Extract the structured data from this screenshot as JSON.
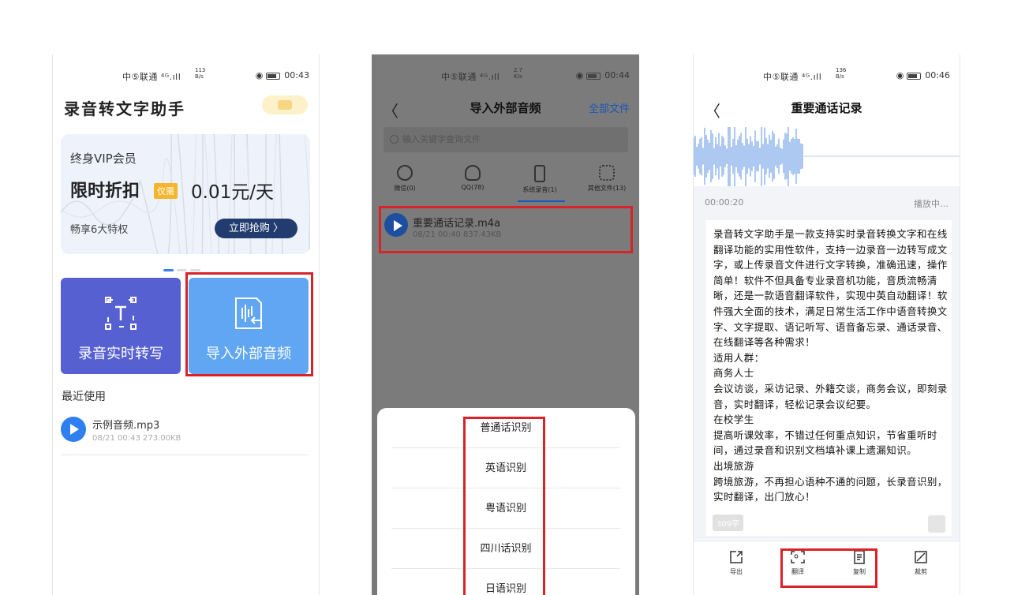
{
  "status_bars": {
    "p1": {
      "carrier": "中⑤联通 ⁴ᴳ.ıll",
      "speed": "113 B/s",
      "time": "00:43"
    },
    "p2": {
      "carrier": "中⑤联通 ⁴ᴳ.ıll",
      "speed": "2.7 K/s",
      "time": "00:44"
    },
    "p3": {
      "carrier": "中⑤联通 ⁴ᴳ.ıll",
      "speed": "136 B/s",
      "time": "00:46"
    }
  },
  "screen1": {
    "title": "录音转文字助手",
    "vip": {
      "title": "终身VIP会员",
      "promo": "限时折扣",
      "tag": "仅需",
      "price": "0.01元/天",
      "perk": "畅享6大特权",
      "button": "立即抢购 〉"
    },
    "tiles": {
      "record": "录音实时转写",
      "import": "导入外部音频"
    },
    "recent_title": "最近使用",
    "recent_item": {
      "name": "示例音频.mp3",
      "meta": "08/21 00:43   273.00KB"
    }
  },
  "screen2": {
    "back": "〈",
    "title": "导入外部音频",
    "right_link": "全部文件",
    "search_placeholder": "输入关键字查询文件",
    "categories": [
      "微信(0)",
      "QQ(78)",
      "系统录音(1)",
      "其他文件(13)"
    ],
    "file": {
      "name": "重要通话记录.m4a",
      "meta": "08/21 00:40   837.43KB"
    },
    "sheet_options": [
      "普通话识别",
      "英语识别",
      "粤语识别",
      "四川话识别",
      "日语识别"
    ]
  },
  "screen3": {
    "back": "〈",
    "title": "重要通话记录",
    "time": "00:00:20",
    "state": "播放中…",
    "transcript": "录音转文字助手是一款支持实时录音转换文字和在线翻译功能的实用性软件，支持一边录音一边转写成文字，或上传录音文件进行文字转换，准确迅速，操作简单！软件不但具备专业录音机功能，音质流畅清晰，还是一款语音翻译软件，实现中英自动翻译！软件强大全面的技术，满足日常生活工作中语音转换文字、文字提取、语记听写、语音备忘录、通话录音、在线翻译等各种需求！\n适用人群：\n商务人士\n会议访谈，采访记录、外籍交谈，商务会议，即刻录音，实时翻译，轻松记录会议纪要。\n在校学生\n提高听课效率，不错过任何重点知识，节省重听时间，通过录音和识别文档填补课上遗漏知识。\n出境旅游\n跨境旅游，不再担心语种不通的问题，长录音识别，实时翻译，出门放心！",
    "word_count": "309字",
    "tools": [
      "导出",
      "翻译",
      "复制",
      "裁剪"
    ]
  },
  "colors": {
    "accent_blue": "#2f7ff0",
    "tile_purple": "#5760d0",
    "tile_blue": "#60a6f3",
    "highlight_red": "#d8232a",
    "vip_btn": "#233c6f",
    "vip_tag": "#f5b62d"
  }
}
